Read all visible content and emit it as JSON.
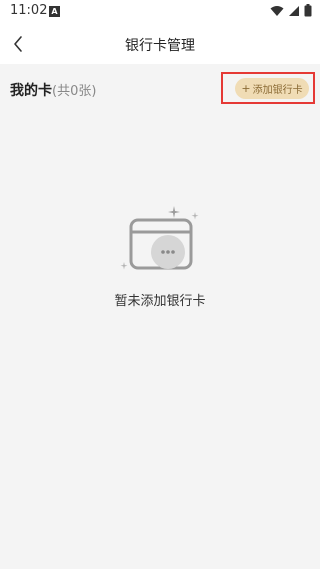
{
  "status_bar": {
    "time": "11:02",
    "badge": "A",
    "icons": [
      "wifi-icon",
      "signal-icon",
      "battery-icon"
    ]
  },
  "nav": {
    "title": "银行卡管理",
    "back_icon": "chevron-left-icon"
  },
  "section": {
    "title": "我的卡",
    "count": "(共0张)",
    "add_button_label": "添加银行卡",
    "add_button_icon": "plus-icon"
  },
  "empty_state": {
    "message": "暂未添加银行卡",
    "illustration": "card-empty-icon"
  },
  "colors": {
    "accent_bg": "#f0dcb5",
    "accent_text": "#8b6b35",
    "highlight_border": "#e53935"
  }
}
